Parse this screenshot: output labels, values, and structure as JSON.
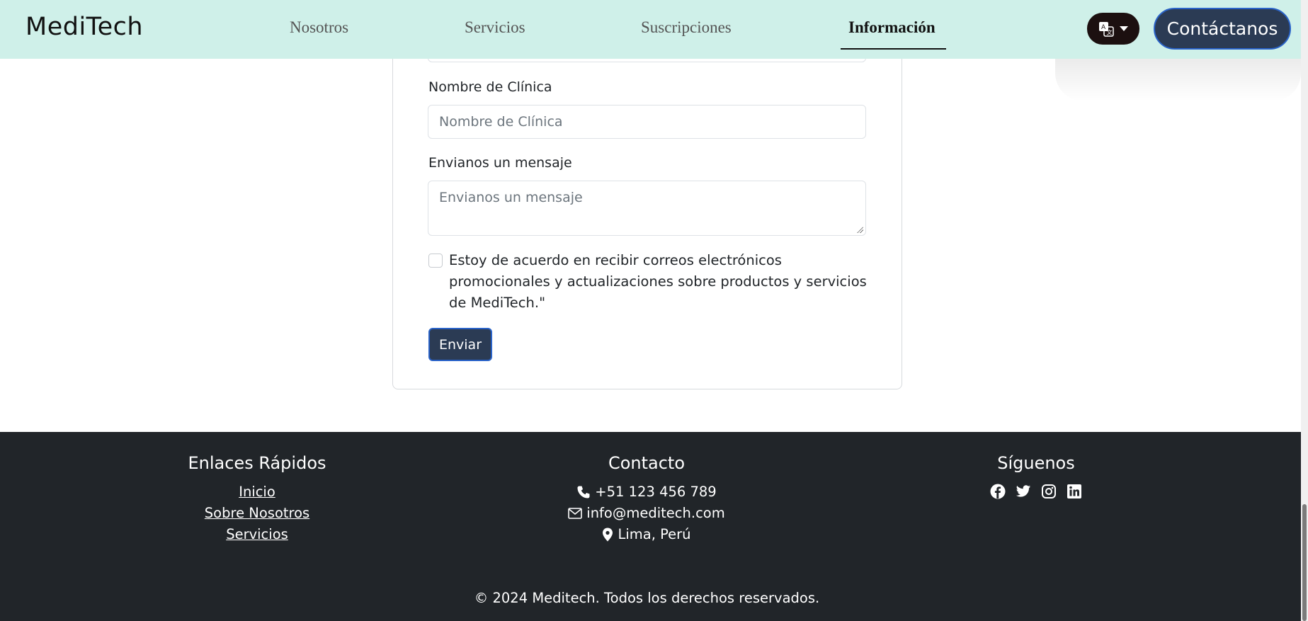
{
  "navbar": {
    "brand": "MediTech",
    "links": [
      "Nosotros",
      "Servicios",
      "Suscripciones",
      "Información"
    ],
    "active_link": "Información",
    "language_icon": "translate-icon",
    "contact_label": "Contáctanos",
    "background_color": "#cff0e9"
  },
  "form": {
    "clinic_label": "Nombre de Clínica",
    "clinic_placeholder": "Nombre de Clínica",
    "message_label": "Envianos un mensaje",
    "message_placeholder": "Envianos un mensaje",
    "consent_checked": false,
    "consent_text": "Estoy de acuerdo en recibir correos electrónicos promocionales y actualizaciones sobre productos y servicios de MediTech.\"",
    "submit_label": "Enviar",
    "button_color": "#2b3b54"
  },
  "footer": {
    "background_color": "#212529",
    "quick_links": {
      "title": "Enlaces Rápidos",
      "items": [
        "Inicio",
        "Sobre Nosotros",
        "Servicios"
      ]
    },
    "contact": {
      "title": "Contacto",
      "phone": "+51 123 456 789",
      "email": "info@meditech.com",
      "location": "Lima, Perú"
    },
    "social": {
      "title": "Síguenos",
      "icons": [
        "facebook-icon",
        "twitter-icon",
        "instagram-icon",
        "linkedin-icon"
      ]
    },
    "copyright": "© 2024 Meditech. Todos los derechos reservados."
  }
}
